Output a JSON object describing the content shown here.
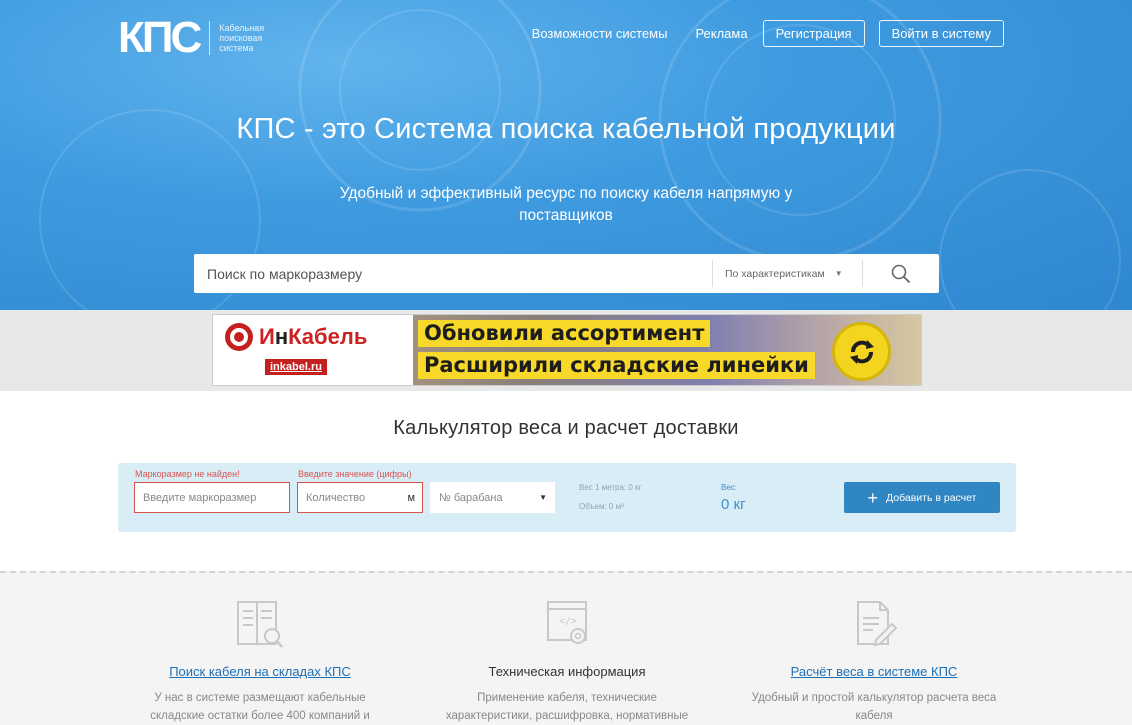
{
  "logo": {
    "mark": "КПС",
    "subtitle_line1": "Кабельная",
    "subtitle_line2": "поисковая",
    "subtitle_line3": "система"
  },
  "nav": {
    "features": "Возможности системы",
    "ads": "Реклама",
    "register": "Регистрация",
    "login": "Войти в систему"
  },
  "hero": {
    "title": "КПС - это Система поиска кабельной продукции",
    "tagline": "Удобный и эффективный ресурс по поиску кабеля напрямую у поставщиков"
  },
  "search": {
    "placeholder": "Поиск по маркоразмеру",
    "mode": "По характеристикам"
  },
  "banner": {
    "brand_prefix": "И",
    "brand_mid": "н",
    "brand_suffix": "Кабель",
    "url": "inkabel.ru",
    "line1": "Обновили ассортимент",
    "line2": "Расширили складские линейки"
  },
  "calc": {
    "title": "Калькулятор веса и расчет доставки",
    "mark_error": "Маркоразмер не найден!",
    "qty_error": "Введите значение (цифры)",
    "mark_placeholder": "Введите маркоразмер",
    "qty_placeholder": "Количество",
    "qty_unit": "м",
    "drum_placeholder": "№ барабана",
    "weight_per_meter": "Вес 1 метра: 0 кг",
    "volume": "Объем: 0 м³",
    "weight_label": "Вес:",
    "weight_value": "0 кг",
    "add_button": "Добавить в расчет"
  },
  "features": [
    {
      "title": "Поиск кабеля на складах КПС",
      "text_line1": "У нас в системе размещают кабельные",
      "text_line2": "складские остатки более 400 компаний и",
      "icon": "book-search-icon"
    },
    {
      "title": "Техническая информация",
      "text_line1": "Применение кабеля, технические",
      "text_line2": "характеристики, расшифровка, нормативные",
      "icon": "code-settings-icon"
    },
    {
      "title": "Расчёт веса в системе КПС",
      "text_line1": "Удобный и простой калькулятор расчета веса",
      "text_line2": "кабеля",
      "icon": "document-edit-icon"
    }
  ],
  "colors": {
    "hero": "#3f9be0",
    "accent": "#2f86c3",
    "error": "#d9534f",
    "banner_yellow": "#f8d92a"
  }
}
